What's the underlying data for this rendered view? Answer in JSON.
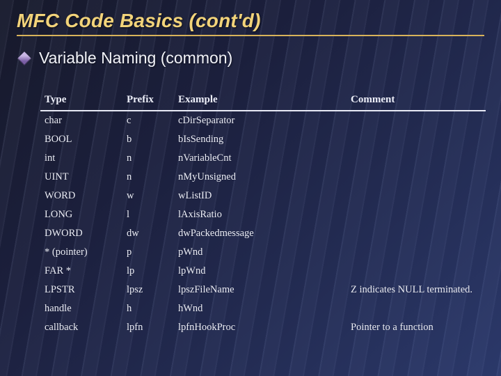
{
  "slide_title": "MFC Code Basics (cont'd)",
  "bullet_text": "Variable Naming (common)",
  "table": {
    "headers": {
      "type": "Type",
      "prefix": "Prefix",
      "example": "Example",
      "comment": "Comment"
    },
    "rows": [
      {
        "type": "char",
        "prefix": "c",
        "example": "cDirSeparator",
        "comment": ""
      },
      {
        "type": "BOOL",
        "prefix": "b",
        "example": "bIsSending",
        "comment": ""
      },
      {
        "type": "int",
        "prefix": "n",
        "example": "nVariableCnt",
        "comment": ""
      },
      {
        "type": "UINT",
        "prefix": "n",
        "example": "nMyUnsigned",
        "comment": ""
      },
      {
        "type": "WORD",
        "prefix": "w",
        "example": "wListID",
        "comment": ""
      },
      {
        "type": "LONG",
        "prefix": "l",
        "example": "lAxisRatio",
        "comment": ""
      },
      {
        "type": "DWORD",
        "prefix": "dw",
        "example": "dwPackedmessage",
        "comment": ""
      },
      {
        "type": "* (pointer)",
        "prefix": "p",
        "example": "pWnd",
        "comment": ""
      },
      {
        "type": "FAR *",
        "prefix": "lp",
        "example": "lpWnd",
        "comment": ""
      },
      {
        "type": "LPSTR",
        "prefix": "lpsz",
        "example": "lpszFileName",
        "comment": "Z indicates NULL terminated."
      },
      {
        "type": "handle",
        "prefix": "h",
        "example": "hWnd",
        "comment": ""
      },
      {
        "type": "callback",
        "prefix": "lpfn",
        "example": "lpfnHookProc",
        "comment": "Pointer to a function"
      }
    ]
  }
}
